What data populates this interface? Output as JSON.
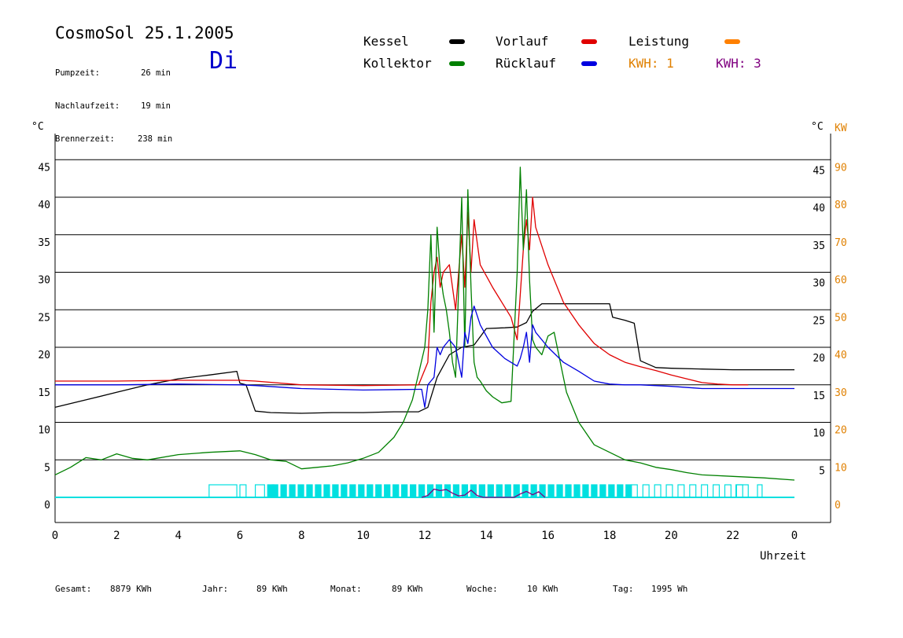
{
  "header": {
    "title": "CosmoSol 25.1.2005",
    "day": "Di",
    "info": [
      {
        "label": "Pumpzeit:",
        "value": "26 min"
      },
      {
        "label": "Nachlaufzeit:",
        "value": "19 min"
      },
      {
        "label": "Brennerzeit:",
        "value": "238 min"
      }
    ]
  },
  "legend": {
    "kessel": {
      "label": "Kessel",
      "color": "#000000"
    },
    "vorlauf": {
      "label": "Vorlauf",
      "color": "#e00000"
    },
    "leistung": {
      "label": "Leistung",
      "color": "#ff8000"
    },
    "kollektor": {
      "label": "Kollektor",
      "color": "#008000"
    },
    "ruecklauf": {
      "label": "Rücklauf",
      "color": "#0000e0"
    },
    "kwh1": {
      "label": "KWH: 1",
      "color": "#e08000"
    },
    "kwh3": {
      "label": "KWH: 3",
      "color": "#800080"
    }
  },
  "footer": {
    "gesamt_label": "Gesamt:",
    "gesamt_value": "8879 KWh",
    "jahr_label": "Jahr:",
    "jahr_value": "89 KWh",
    "monat_label": "Monat:",
    "monat_value": "89 KWh",
    "woche_label": "Woche:",
    "woche_value": "10 KWh",
    "tag_label": "Tag:",
    "tag_value": "1995 Wh"
  },
  "chart_data": {
    "type": "line",
    "xlabel": "Uhrzeit",
    "ylabel_left": "°C",
    "ylabel_right_c": "°C",
    "ylabel_right_kw": "KW",
    "xlim": [
      0,
      24
    ],
    "ylim": [
      0,
      50
    ],
    "ylim_kw": [
      0,
      100
    ],
    "x_ticks": [
      "0",
      "2",
      "4",
      "6",
      "8",
      "10",
      "12",
      "14",
      "16",
      "18",
      "20",
      "22",
      "0"
    ],
    "y_ticks": [
      0,
      5,
      10,
      15,
      20,
      25,
      30,
      35,
      40,
      45
    ],
    "kw_ticks": [
      0,
      10,
      20,
      30,
      40,
      50,
      60,
      70,
      80,
      90
    ],
    "grid": true,
    "series": [
      {
        "name": "Kessel",
        "color": "#000000",
        "x": [
          0,
          1,
          2,
          3,
          4,
          5,
          5.9,
          6,
          6.2,
          6.5,
          7,
          8,
          9,
          10,
          11,
          11.8,
          12.1,
          12.4,
          12.8,
          13.2,
          13.6,
          14,
          14.6,
          15,
          15.3,
          15.5,
          15.8,
          16.5,
          17,
          17.5,
          18,
          18.1,
          18.5,
          18.8,
          19,
          19.5,
          20,
          21,
          22,
          23,
          24
        ],
        "y": [
          12,
          13,
          14,
          15,
          15.8,
          16.3,
          16.8,
          15.2,
          15,
          11.5,
          11.3,
          11.2,
          11.3,
          11.3,
          11.4,
          11.4,
          12,
          16,
          19,
          20,
          20.3,
          22.5,
          22.6,
          22.7,
          23.3,
          24.8,
          25.8,
          25.8,
          25.8,
          25.8,
          25.8,
          24,
          23.6,
          23.2,
          18.2,
          17.3,
          17.2,
          17.1,
          17.0,
          17.0,
          17.0
        ]
      },
      {
        "name": "Vorlauf",
        "color": "#e00000",
        "x": [
          0,
          2,
          4,
          6,
          6.5,
          8,
          10,
          11.8,
          12.1,
          12.2,
          12.3,
          12.4,
          12.5,
          12.6,
          12.8,
          13,
          13.2,
          13.3,
          13.4,
          13.5,
          13.6,
          13.8,
          14.2,
          14.8,
          15,
          15.2,
          15.3,
          15.4,
          15.5,
          15.6,
          16,
          16.5,
          17,
          17.5,
          18,
          18.5,
          19,
          19.5,
          20,
          20.5,
          21,
          21.5,
          22,
          22.5
        ],
        "y": [
          15.5,
          15.5,
          15.6,
          15.6,
          15.5,
          15.0,
          14.9,
          15.0,
          18,
          26,
          30,
          32,
          28,
          30,
          31,
          25,
          35,
          28,
          38,
          30,
          37,
          31,
          28,
          24,
          21,
          33,
          37,
          33,
          40,
          36,
          31,
          26,
          23,
          20.5,
          19,
          18,
          17.4,
          16.9,
          16.3,
          15.8,
          15.3,
          15.1,
          15.0,
          15.0
        ]
      },
      {
        "name": "Kollektor",
        "color": "#008000",
        "x": [
          0,
          0.5,
          1,
          1.5,
          2,
          2.5,
          3,
          4,
          5,
          6,
          6.5,
          7,
          7.5,
          8,
          8.5,
          9,
          9.5,
          10,
          10.5,
          11,
          11.3,
          11.6,
          11.8,
          12,
          12.1,
          12.2,
          12.3,
          12.4,
          12.5,
          12.6,
          12.7,
          12.8,
          12.9,
          13,
          13.2,
          13.3,
          13.4,
          13.5,
          13.6,
          13.7,
          13.8,
          14,
          14.2,
          14.5,
          14.8,
          15,
          15.1,
          15.2,
          15.3,
          15.4,
          15.5,
          15.6,
          15.8,
          16,
          16.2,
          16.4,
          16.6,
          17,
          17.5,
          18,
          18.5,
          19,
          19.5,
          20,
          20.5,
          21,
          22,
          23,
          24
        ],
        "y": [
          3,
          4,
          5.3,
          5,
          5.8,
          5.2,
          5,
          5.7,
          6,
          6.2,
          5.7,
          5,
          4.8,
          3.8,
          4,
          4.2,
          4.6,
          5.2,
          6,
          8,
          10,
          13,
          16.5,
          20,
          25,
          35,
          22,
          36,
          30,
          27,
          25,
          22,
          18,
          16,
          40,
          20,
          41,
          28,
          18,
          16,
          15.5,
          14.2,
          13.4,
          12.6,
          12.8,
          30,
          44,
          33,
          41,
          29,
          21,
          20,
          19,
          21.5,
          22,
          18,
          14,
          10,
          7,
          6,
          5,
          4.6,
          4.0,
          3.7,
          3.3,
          3.0,
          2.8,
          2.6,
          2.3
        ]
      },
      {
        "name": "Rücklauf",
        "color": "#0000e0",
        "x": [
          0,
          2,
          4,
          6,
          6.5,
          8,
          10,
          11.8,
          11.9,
          12,
          12.1,
          12.2,
          12.3,
          12.4,
          12.5,
          12.6,
          12.8,
          13,
          13.1,
          13.2,
          13.3,
          13.4,
          13.5,
          13.6,
          13.8,
          14.2,
          14.6,
          15,
          15.1,
          15.2,
          15.3,
          15.4,
          15.5,
          15.6,
          16,
          16.5,
          17,
          17.5,
          18,
          18.5,
          19,
          20,
          21,
          22,
          23,
          24
        ],
        "y": [
          15,
          15,
          15.1,
          15,
          14.9,
          14.5,
          14.3,
          14.4,
          14.4,
          12,
          15,
          15.5,
          16,
          20,
          19,
          20,
          21,
          20,
          18,
          16,
          22,
          20.5,
          24,
          25.5,
          23,
          20,
          18.5,
          17.5,
          18.5,
          20,
          22,
          18,
          23,
          22,
          20,
          18,
          16.8,
          15.5,
          15.1,
          15.0,
          15.0,
          14.8,
          14.5,
          14.5,
          14.5,
          14.5
        ]
      },
      {
        "name": "Leistung",
        "color": "#800080",
        "axis": "kw",
        "x": [
          11.9,
          12.1,
          12.3,
          12.5,
          12.7,
          12.9,
          13.1,
          13.3,
          13.5,
          13.7,
          13.9,
          14.9,
          15.1,
          15.3,
          15.5,
          15.7,
          15.9
        ],
        "y": [
          0,
          0.5,
          2.2,
          1.8,
          2.1,
          1.1,
          0.4,
          0.6,
          1.9,
          0.5,
          0,
          0,
          0.9,
          1.6,
          0.7,
          1.5,
          0
        ]
      }
    ],
    "pump_bars_color": "#00e0e0"
  }
}
